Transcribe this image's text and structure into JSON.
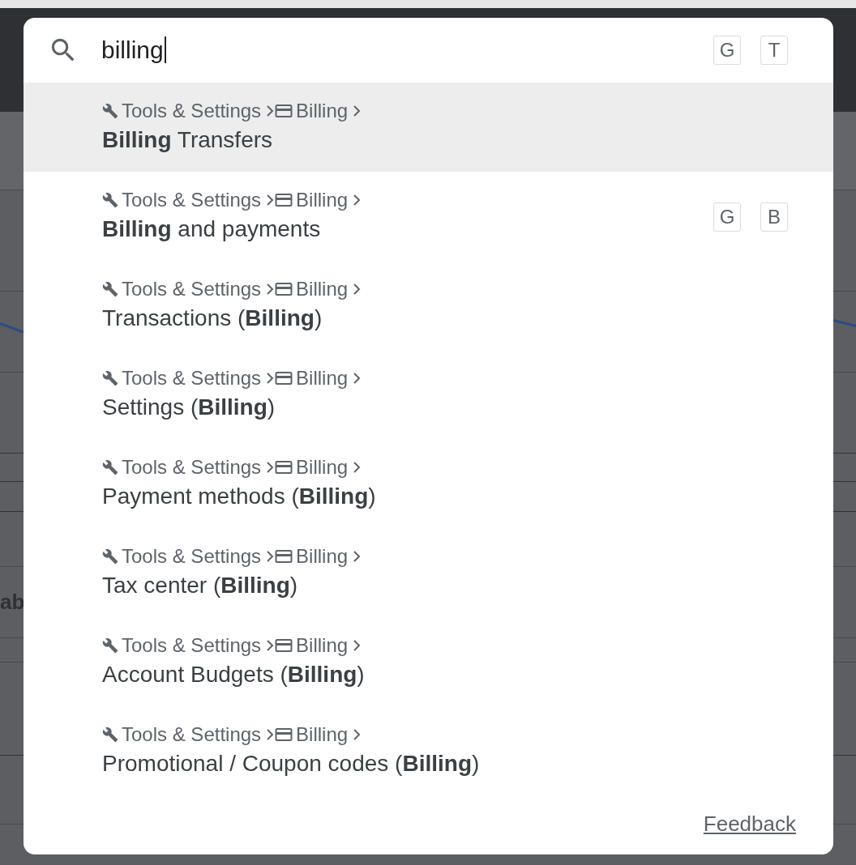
{
  "background": {
    "side_text": "ab"
  },
  "search": {
    "value": "billing",
    "shortcut_keys": [
      "G",
      "T"
    ]
  },
  "results": [
    {
      "path": [
        "Tools & Settings",
        "Billing"
      ],
      "title": "**Billing** Transfers",
      "selected": true
    },
    {
      "path": [
        "Tools & Settings",
        "Billing"
      ],
      "title": "**Billing** and payments",
      "selected": false,
      "shortcut_keys": [
        "G",
        "B"
      ]
    },
    {
      "path": [
        "Tools & Settings",
        "Billing"
      ],
      "title": "Transactions (**Billing**)",
      "selected": false
    },
    {
      "path": [
        "Tools & Settings",
        "Billing"
      ],
      "title": "Settings (**Billing**)",
      "selected": false
    },
    {
      "path": [
        "Tools & Settings",
        "Billing"
      ],
      "title": "Payment methods (**Billing**)",
      "selected": false
    },
    {
      "path": [
        "Tools & Settings",
        "Billing"
      ],
      "title": "Tax center (**Billing**)",
      "selected": false
    },
    {
      "path": [
        "Tools & Settings",
        "Billing"
      ],
      "title": "Account Budgets (**Billing**)",
      "selected": false
    },
    {
      "path": [
        "Tools & Settings",
        "Billing"
      ],
      "title": "Promotional / Coupon codes (**Billing**)",
      "selected": false
    }
  ],
  "feedback_link": "Feedback"
}
